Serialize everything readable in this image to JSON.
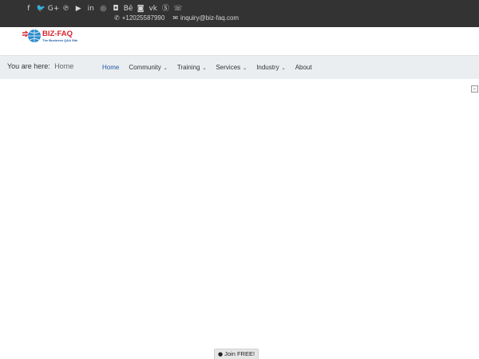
{
  "topbar": {
    "social_icons": [
      "facebook-icon",
      "twitter-icon",
      "google-plus-icon",
      "pinterest-icon",
      "youtube-icon",
      "linkedin-icon",
      "dribbble-icon",
      "instagram-icon",
      "behance-icon",
      "flickr-icon",
      "vk-icon",
      "skype-icon",
      "whatsapp-icon"
    ],
    "social_glyphs": [
      "f",
      "🐦",
      "G+",
      "℗",
      "▶",
      "in",
      "◎",
      "◘",
      "Bē",
      "◙",
      "vk",
      "Ⓢ",
      "☏"
    ],
    "phone": "+12025587990",
    "email": "inquiry@biz-faq.com",
    "background": "#333333"
  },
  "logo": {
    "title": "BIZ-FAQ",
    "tagline": "The Business Q&A Site",
    "color_red": "#d9232e",
    "color_blue": "#1f5fa8"
  },
  "breadcrumb": {
    "label": "You are here:",
    "current": "Home"
  },
  "nav": {
    "items": [
      {
        "label": "Home",
        "dropdown": false,
        "active": true
      },
      {
        "label": "Community",
        "dropdown": true
      },
      {
        "label": "Training",
        "dropdown": true
      },
      {
        "label": "Services",
        "dropdown": true
      },
      {
        "label": "Industry",
        "dropdown": true
      },
      {
        "label": "About",
        "dropdown": false
      }
    ],
    "active_color": "#1e5aa8"
  },
  "join_button": {
    "label": "Join FREE!"
  }
}
